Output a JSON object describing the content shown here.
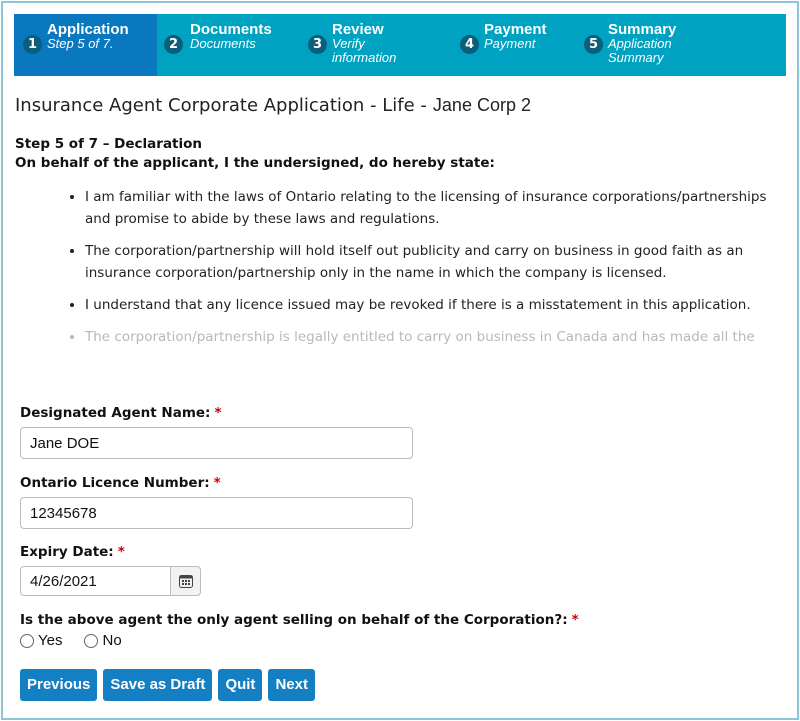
{
  "steps": [
    {
      "num": "1",
      "title": "Application",
      "sub": "Step 5 of 7.",
      "active": true
    },
    {
      "num": "2",
      "title": "Documents",
      "sub": "Documents"
    },
    {
      "num": "3",
      "title": "Review",
      "sub": "Verify information"
    },
    {
      "num": "4",
      "title": "Payment",
      "sub": "Payment"
    },
    {
      "num": "5",
      "title": "Summary",
      "sub": "Application Summary"
    }
  ],
  "page": {
    "title": "Insurance Agent Corporate Application - Life -",
    "corp": "Jane Corp 2",
    "step_heading": "Step 5 of 7 – Declaration",
    "intro": "On behalf of the applicant, I the undersigned, do hereby state:",
    "declarations": [
      "I am familiar with the laws of Ontario relating to the licensing of insurance corporations/partnerships and promise to abide by these laws and regulations.",
      "The corporation/partnership will hold itself out publicity and carry on business in good faith as an insurance corporation/partnership only in the name in which the company is licensed.",
      "I understand that any licence issued may be revoked if there is a misstatement in this application.",
      "The corporation/partnership is legally entitled to carry on business in Canada and has made all the"
    ]
  },
  "form": {
    "agent_label": "Designated Agent Name:",
    "agent_value": "Jane DOE",
    "licence_label": "Ontario Licence Number:",
    "licence_value": "12345678",
    "expiry_label": "Expiry Date:",
    "expiry_value": "4/26/2021",
    "only_agent_label": "Is the above agent the only agent selling on behalf of the Corporation?:",
    "yes": "Yes",
    "no": "No",
    "required": "*"
  },
  "buttons": {
    "previous": "Previous",
    "save": "Save as Draft",
    "quit": "Quit",
    "next": "Next"
  },
  "colors": {
    "stepper": "#00a2c2",
    "active_step": "#0a78be",
    "button": "#1480c3",
    "required": "#cc0000"
  }
}
